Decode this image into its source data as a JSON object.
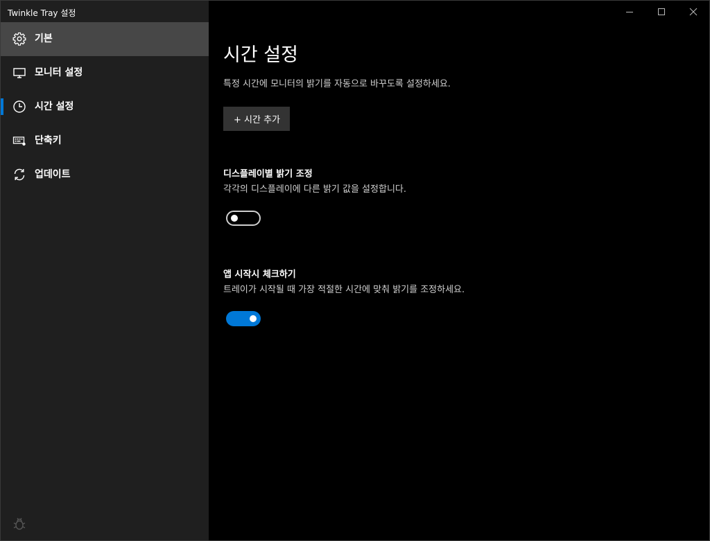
{
  "window": {
    "title": "Twinkle Tray 설정"
  },
  "sidebar": {
    "items": [
      {
        "label": "기본",
        "icon": "gear-icon"
      },
      {
        "label": "모니터 설정",
        "icon": "monitor-icon"
      },
      {
        "label": "시간 설정",
        "icon": "clock-icon"
      },
      {
        "label": "단축키",
        "icon": "keyboard-icon"
      },
      {
        "label": "업데이트",
        "icon": "refresh-icon"
      }
    ],
    "selected": "시간 설정",
    "hovered": "기본"
  },
  "main": {
    "title": "시간 설정",
    "description": "특정 시간에 모니터의 밝기를 자동으로 바꾸도록 설정하세요.",
    "add_time_label": "+ 시간 추가",
    "per_display": {
      "title": "디스플레이별 밝기 조정",
      "description": "각각의 디스플레이에 다른 밝기 값을 설정합니다.",
      "enabled": false
    },
    "check_on_start": {
      "title": "앱 시작시 체크하기",
      "description": "트레이가 시작될 때 가장 적절한 시간에 맞춰 밝기를 조정하세요.",
      "enabled": true
    }
  },
  "colors": {
    "accent": "#0078d7",
    "sidebar_bg": "#1f1f1f",
    "main_bg": "#000000",
    "hover_bg": "#474747",
    "button_bg": "#333333"
  }
}
